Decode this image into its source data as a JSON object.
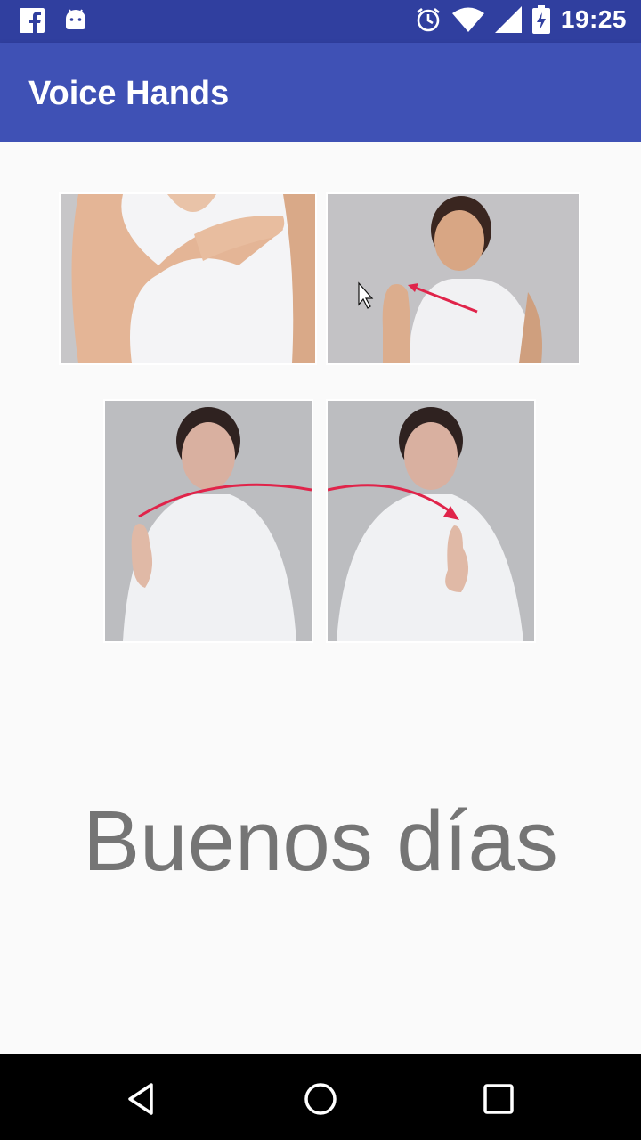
{
  "status_bar": {
    "time": "19:25",
    "left_icons": [
      "facebook-icon",
      "android-icon"
    ],
    "right_icons": [
      "alarm-icon",
      "wifi-icon",
      "signal-icon",
      "battery-charging-icon"
    ]
  },
  "app_bar": {
    "title": "Voice Hands"
  },
  "sign": {
    "photos": [
      {
        "name": "sign-photo-1",
        "subject": "hand-on-chest"
      },
      {
        "name": "sign-photo-2",
        "subject": "girl-raised-hand-arrow"
      },
      {
        "name": "sign-photo-3",
        "subject": "woman-finger-arc-start"
      },
      {
        "name": "sign-photo-4",
        "subject": "woman-finger-arc-end"
      }
    ],
    "text": "Buenos días"
  },
  "nav_bar": {
    "buttons": [
      "back-icon",
      "home-icon",
      "recents-icon"
    ]
  },
  "colors": {
    "status_bar": "#303f9f",
    "app_bar": "#3f51b5",
    "background": "#fafafa",
    "text": "#757575",
    "arrow": "#e0244a"
  }
}
